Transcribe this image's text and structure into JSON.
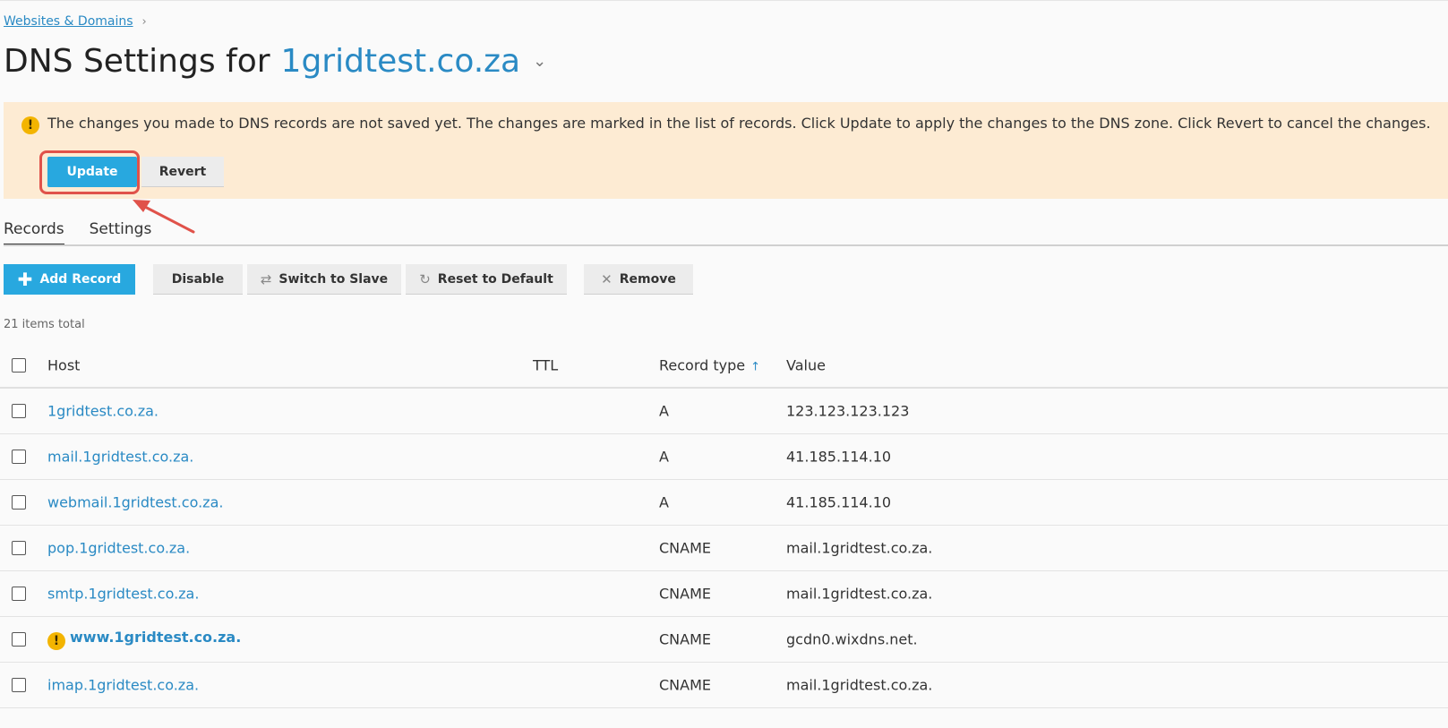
{
  "breadcrumb": {
    "item": "Websites & Domains",
    "sep": "›"
  },
  "title": {
    "prefix": "DNS Settings for",
    "domain": "1gridtest.co.za",
    "caret": "⌄"
  },
  "warning": {
    "icon": "!",
    "text": "The changes you made to DNS records are not saved yet. The changes are marked in the list of records. Click Update to apply the changes to the DNS zone. Click Revert to cancel the changes.",
    "update_label": "Update",
    "revert_label": "Revert"
  },
  "tabs": [
    {
      "label": "Records",
      "active": true
    },
    {
      "label": "Settings",
      "active": false
    }
  ],
  "toolbar": {
    "add_label": "Add Record",
    "disable_label": "Disable",
    "slave_label": "Switch to Slave",
    "reset_label": "Reset to Default",
    "remove_label": "Remove"
  },
  "count_text": "21 items total",
  "table": {
    "columns": {
      "host": "Host",
      "ttl": "TTL",
      "type": "Record type",
      "value": "Value",
      "sort_indicator": "↑"
    },
    "rows": [
      {
        "host": "1gridtest.co.za.",
        "ttl": "",
        "type": "A",
        "value": "123.123.123.123"
      },
      {
        "host": "mail.1gridtest.co.za.",
        "ttl": "",
        "type": "A",
        "value": "41.185.114.10"
      },
      {
        "host": "webmail.1gridtest.co.za.",
        "ttl": "",
        "type": "A",
        "value": "41.185.114.10"
      },
      {
        "host": "pop.1gridtest.co.za.",
        "ttl": "",
        "type": "CNAME",
        "value": "mail.1gridtest.co.za."
      },
      {
        "host": "smtp.1gridtest.co.za.",
        "ttl": "",
        "type": "CNAME",
        "value": "mail.1gridtest.co.za."
      },
      {
        "host": "www.1gridtest.co.za.",
        "ttl": "",
        "type": "CNAME",
        "value": "gcdn0.wixdns.net.",
        "changed_marker": "!"
      },
      {
        "host": "imap.1gridtest.co.za.",
        "ttl": "",
        "type": "CNAME",
        "value": "mail.1gridtest.co.za."
      }
    ]
  },
  "colors": {
    "accent": "#28a8df",
    "link": "#2a8ac4",
    "warning_bg": "#fdebd3",
    "highlight": "#e0524a"
  }
}
